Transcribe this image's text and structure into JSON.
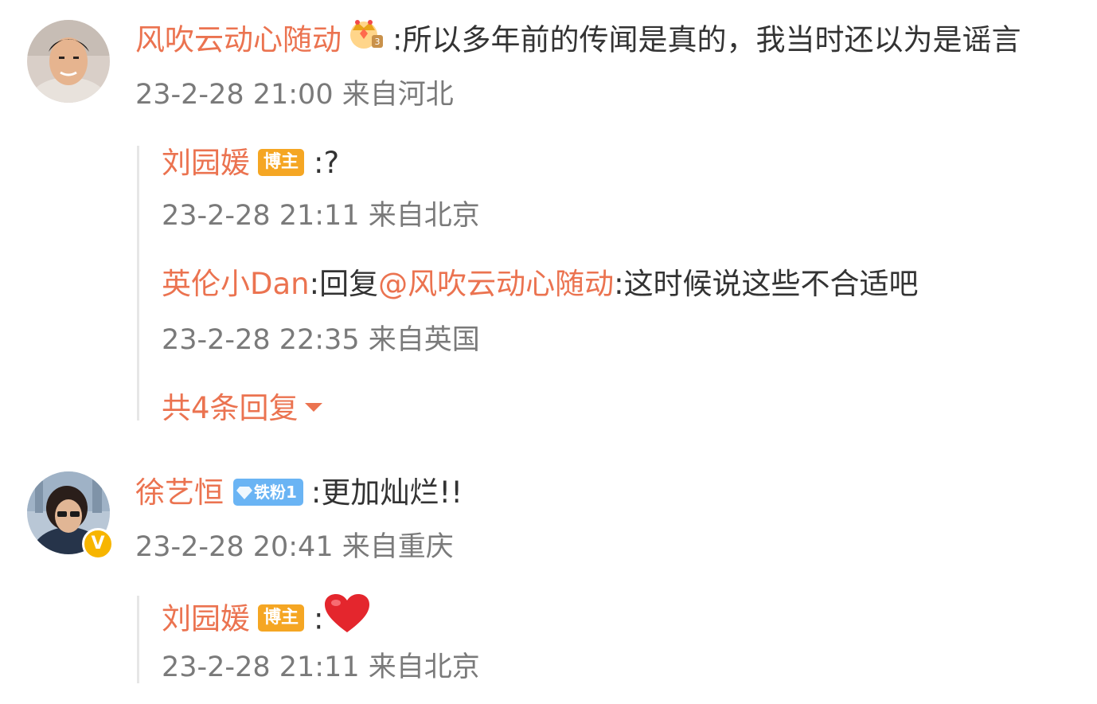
{
  "comments": [
    {
      "author": "风吹云动心随动",
      "sep": ":",
      "text": "所以多年前的传闻是真的，我当时还以为是谣言",
      "meta": "23-2-28 21:00 来自河北",
      "replies": [
        {
          "author": "刘园媛",
          "badge": "博主",
          "sep": ":",
          "text": "?",
          "meta": "23-2-28 21:11 来自北京"
        },
        {
          "author": "英伦小Dan",
          "sep": ":",
          "prefix": "回复",
          "mention": "@风吹云动心随动",
          "sep2": ":",
          "text": "这时候说这些不合适吧",
          "meta": "23-2-28 22:35 来自英国"
        }
      ],
      "more_replies": "共4条回复"
    },
    {
      "author": "徐艺恒",
      "fan_badge": "铁粉1",
      "verified": "V",
      "sep": ":",
      "text": "更加灿烂!!",
      "meta": "23-2-28 20:41 来自重庆",
      "replies": [
        {
          "author": "刘园媛",
          "badge": "博主",
          "sep": ":",
          "meta": "23-2-28 21:11 来自北京"
        }
      ]
    }
  ],
  "colors": {
    "name": "#eb7350",
    "meta": "#7a7a7a",
    "badge_blogger": "#f5a623",
    "badge_fan": "#6ab4f4",
    "verified": "#f7b500"
  },
  "icons": {
    "crown": "crown-icon",
    "heart": "heart-icon",
    "caret": "caret-down-icon",
    "diamond": "diamond-icon"
  }
}
